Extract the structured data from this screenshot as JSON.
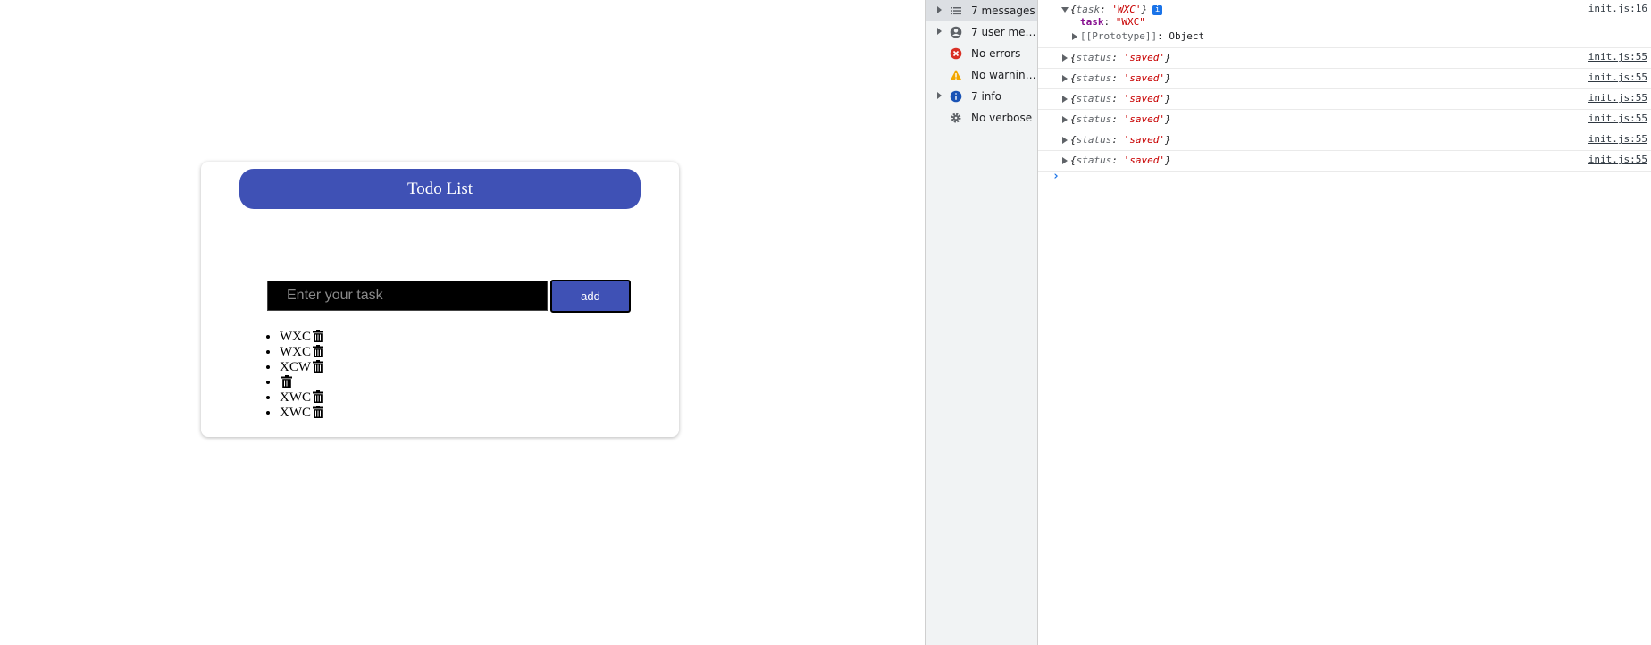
{
  "app": {
    "header_title": "Todo List",
    "input": {
      "placeholder": "Enter your task",
      "value": ""
    },
    "add_button_label": "add",
    "tasks": [
      "WXC",
      "WXC",
      "XCW",
      "",
      "XWC",
      "XWC"
    ],
    "icons": {
      "delete": "trash-icon"
    },
    "colors": {
      "accent": "#3f51b5",
      "input_bg": "#000000"
    }
  },
  "devtools": {
    "sidebar": [
      {
        "label": "7 messages",
        "icon": "list-icon",
        "expandable": true,
        "selected": true
      },
      {
        "label": "7 user mes…",
        "icon": "user-icon",
        "expandable": true,
        "selected": false
      },
      {
        "label": "No errors",
        "icon": "error-icon",
        "expandable": false,
        "selected": false
      },
      {
        "label": "No warnings",
        "icon": "warning-icon",
        "expandable": false,
        "selected": false
      },
      {
        "label": "7 info",
        "icon": "info-icon",
        "expandable": true,
        "selected": false
      },
      {
        "label": "No verbose",
        "icon": "gear-icon",
        "expandable": false,
        "selected": false
      }
    ],
    "messages": [
      {
        "key": "task",
        "value": "'WXC'",
        "source": "init.js:16",
        "expanded": true,
        "children": [
          {
            "key": "task",
            "value": "\"WXC\""
          },
          {
            "key": "[[Prototype]]",
            "value": "Object"
          }
        ]
      },
      {
        "key": "status",
        "value": "'saved'",
        "source": "init.js:55",
        "expanded": false
      },
      {
        "key": "status",
        "value": "'saved'",
        "source": "init.js:55",
        "expanded": false
      },
      {
        "key": "status",
        "value": "'saved'",
        "source": "init.js:55",
        "expanded": false
      },
      {
        "key": "status",
        "value": "'saved'",
        "source": "init.js:55",
        "expanded": false
      },
      {
        "key": "status",
        "value": "'saved'",
        "source": "init.js:55",
        "expanded": false
      },
      {
        "key": "status",
        "value": "'saved'",
        "source": "init.js:55",
        "expanded": false
      }
    ],
    "colors": {
      "link": "#1a73e8",
      "string": "#c80000",
      "property": "#881391"
    }
  }
}
